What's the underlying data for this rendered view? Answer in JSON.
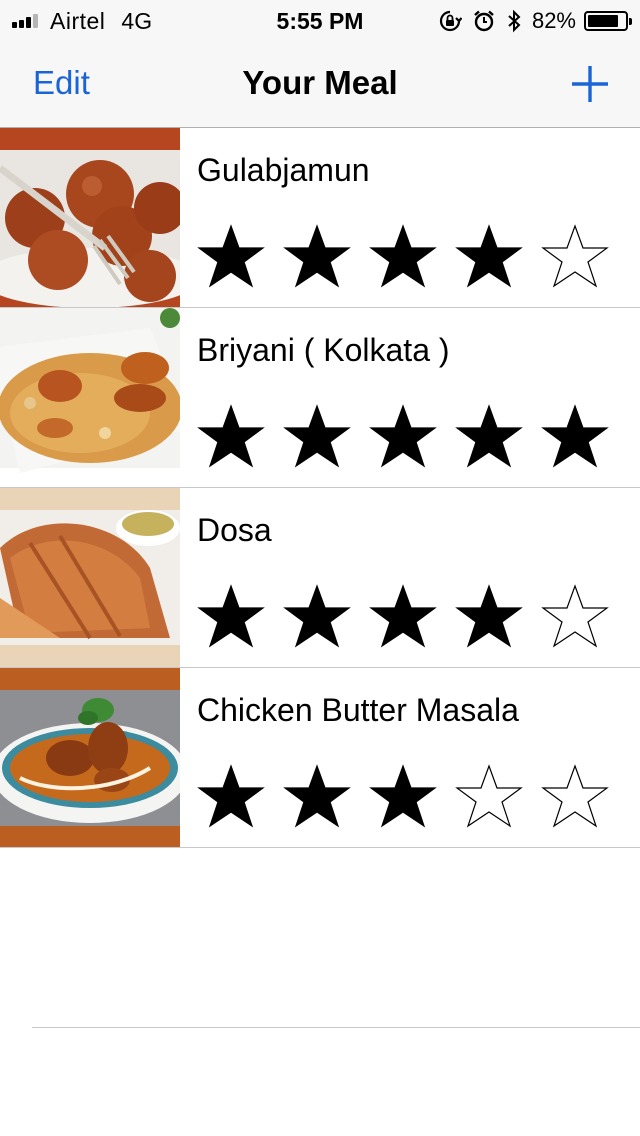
{
  "status_bar": {
    "carrier": "Airtel",
    "network": "4G",
    "time": "5:55 PM",
    "battery": "82%",
    "icons": [
      "signal-icon",
      "rotation-lock-icon",
      "alarm-icon",
      "bluetooth-icon",
      "battery-icon"
    ]
  },
  "nav": {
    "edit_label": "Edit",
    "title": "Your Meal",
    "add_icon": "plus-icon",
    "accent": "#1a64d6"
  },
  "meals": [
    {
      "name": "Gulabjamun",
      "rating": 4,
      "max_rating": 5,
      "photo": "gulabjamun-photo"
    },
    {
      "name": "Briyani ( Kolkata )",
      "rating": 5,
      "max_rating": 5,
      "photo": "biryani-photo"
    },
    {
      "name": "Dosa",
      "rating": 4,
      "max_rating": 5,
      "photo": "dosa-photo"
    },
    {
      "name": "Chicken Butter Masala",
      "rating": 3,
      "max_rating": 5,
      "photo": "butter-chicken-photo"
    }
  ]
}
